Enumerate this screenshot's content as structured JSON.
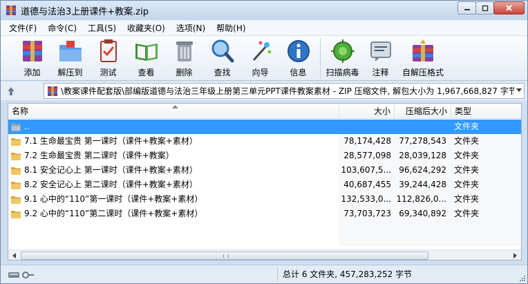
{
  "window": {
    "title": "道德与法治3上册课件+教案.zip"
  },
  "menu": [
    "文件(F)",
    "命令(C)",
    "工具(S)",
    "收藏夹(O)",
    "选项(N)",
    "帮助(H)"
  ],
  "toolbar": [
    {
      "label": "添加",
      "icon": "add-archive-icon"
    },
    {
      "label": "解压到",
      "icon": "extract-to-icon"
    },
    {
      "label": "测试",
      "icon": "test-icon"
    },
    {
      "label": "查看",
      "icon": "view-icon"
    },
    {
      "label": "删除",
      "icon": "delete-icon"
    },
    {
      "label": "查找",
      "icon": "find-icon"
    },
    {
      "label": "向导",
      "icon": "wizard-icon"
    },
    {
      "label": "信息",
      "icon": "info-icon"
    },
    {
      "label": "扫描病毒",
      "icon": "virus-scan-icon"
    },
    {
      "label": "注释",
      "icon": "comment-icon"
    },
    {
      "label": "自解压格式",
      "icon": "sfx-icon"
    }
  ],
  "address": {
    "path": "\\教案课件配套版\\部编版道德与法治三年级上册第三单元PPT课件教案素材 - ZIP 压缩文件, 解包大小为 1,967,668,827 字节"
  },
  "columns": {
    "name": "名称",
    "size": "大小",
    "packed": "压缩后大小",
    "type": "类型"
  },
  "rows": [
    {
      "name": "..",
      "size": "",
      "packed": "",
      "type": "文件夹",
      "selected": true
    },
    {
      "name": "7.1 生命最宝贵  第一课时（课件+教案+素材）",
      "size": "78,174,428",
      "packed": "77,278,543",
      "type": "文件夹"
    },
    {
      "name": "7.2 生命最宝贵  第二课时（课件+教案）",
      "size": "28,577,098",
      "packed": "28,039,128",
      "type": "文件夹"
    },
    {
      "name": "8.1 安全记心上  第一课时（课件+教案+素材）",
      "size": "103,607,5...",
      "packed": "96,624,292",
      "type": "文件夹"
    },
    {
      "name": "8.2 安全记心上  第二课时（课件+教案+素材）",
      "size": "40,687,455",
      "packed": "39,244,428",
      "type": "文件夹"
    },
    {
      "name": "9.1 心中的“110”第一课时（课件+教案+素材）",
      "size": "132,533,0...",
      "packed": "112,826,0...",
      "type": "文件夹"
    },
    {
      "name": "9.2 心中的“110”第二课时（课件+教案+素材）",
      "size": "73,703,723",
      "packed": "69,340,892",
      "type": "文件夹"
    }
  ],
  "status": {
    "summary": "总计 6 文件夹, 457,283,252 字节"
  },
  "colors": {
    "selection": "#3399ff",
    "folder": "#e8b64a"
  }
}
